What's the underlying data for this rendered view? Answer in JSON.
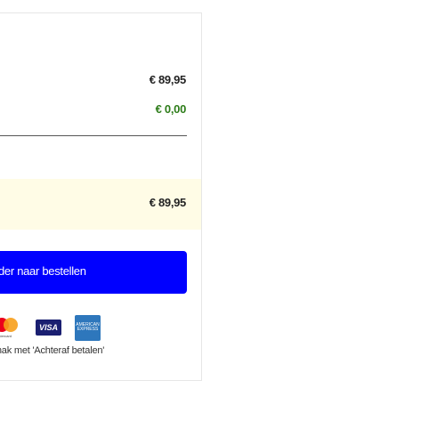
{
  "summary": {
    "subtotal": "€ 89,95",
    "shipping": "€ 0,00",
    "total": "€ 89,95"
  },
  "checkout": {
    "button_label": "der naar bestellen"
  },
  "payment": {
    "logos": [
      {
        "name": "mastercard",
        "label": "mastercard"
      },
      {
        "name": "visa",
        "label": "VISA"
      },
      {
        "name": "amex",
        "label": "AMERICAN EXPRESS"
      }
    ],
    "afterpay_text": "gemak met 'Achteraf betalen'"
  },
  "colors": {
    "button_bg": "#0000ff",
    "shipping_text": "#2e7d1a",
    "total_bg": "#fffce6"
  }
}
